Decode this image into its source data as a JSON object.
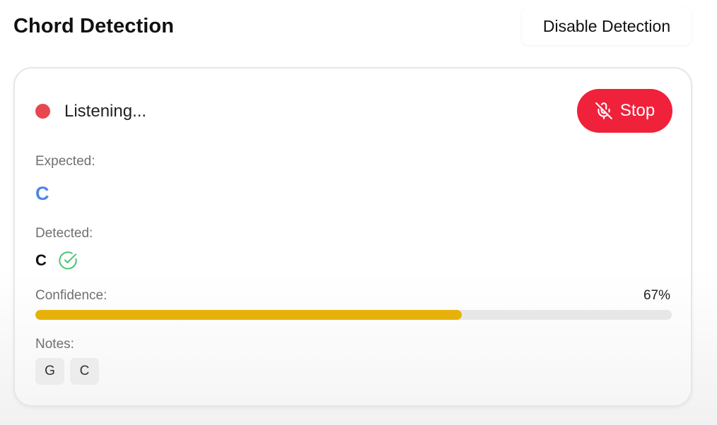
{
  "header": {
    "title": "Chord Detection",
    "disable_button_label": "Disable Detection"
  },
  "card": {
    "status": {
      "text": "Listening...",
      "dot_color": "#e8474f"
    },
    "stop_button": {
      "label": "Stop",
      "icon": "mic-off-icon",
      "color": "#f0213a"
    },
    "expected": {
      "label": "Expected:",
      "value": "C",
      "color": "#4f86e0"
    },
    "detected": {
      "label": "Detected:",
      "value": "C",
      "match_icon": "check-circle-icon",
      "match_color": "#3cc36a"
    },
    "confidence": {
      "label": "Confidence:",
      "percent_text": "67%",
      "value": 0.67,
      "bar_color": "#e6b10a"
    },
    "notes": {
      "label": "Notes:",
      "items": [
        "G",
        "C"
      ]
    }
  }
}
